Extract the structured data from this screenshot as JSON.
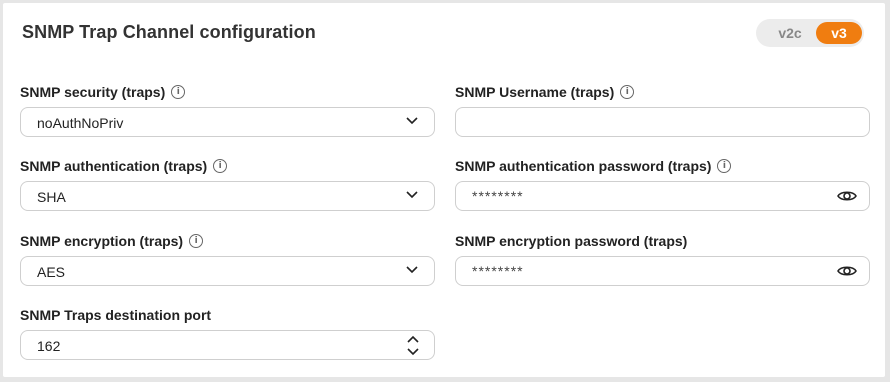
{
  "header": {
    "title": "SNMP Trap Channel configuration",
    "version_toggle": {
      "options": [
        "v2c",
        "v3"
      ],
      "selected": "v3"
    }
  },
  "colors": {
    "accent": "#f07d10",
    "toggle_bg": "#ececec",
    "border": "#cfcfcf"
  },
  "left": {
    "security": {
      "label": "SNMP security (traps)",
      "value": "noAuthNoPriv"
    },
    "authentication": {
      "label": "SNMP authentication (traps)",
      "value": "SHA"
    },
    "encryption": {
      "label": "SNMP encryption (traps)",
      "value": "AES"
    },
    "port": {
      "label": "SNMP Traps destination port",
      "value": "162"
    }
  },
  "right": {
    "username": {
      "label": "SNMP Username (traps)",
      "value": ""
    },
    "auth_password": {
      "label": "SNMP authentication password (traps)",
      "value": "********"
    },
    "enc_password": {
      "label": "SNMP encryption password (traps)",
      "value": "********"
    }
  },
  "icons": {
    "info": "info-icon",
    "dropdown": "chevron-down-icon",
    "reveal": "eye-icon",
    "spinner": "up-down-arrows-icon"
  }
}
